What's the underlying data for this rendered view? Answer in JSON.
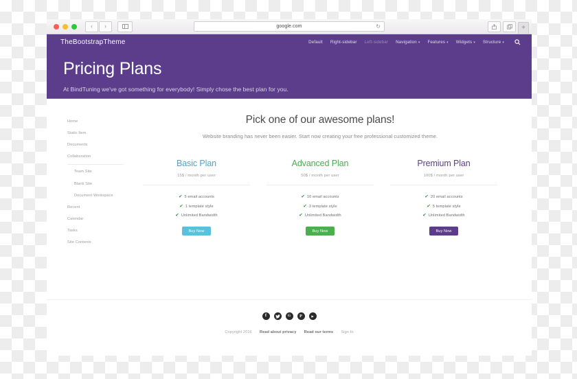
{
  "browser": {
    "traffic_lights": [
      "close",
      "minimize",
      "maximize"
    ],
    "back_label": "‹",
    "forward_label": "›",
    "sidebar_toggle": "sidebar-toggle-icon",
    "url": "google.com",
    "reload_label": "↻",
    "share_icon": "share-icon",
    "tabs_icon": "tabs-icon",
    "new_tab_label": "+"
  },
  "site": {
    "brand": "TheBootstrapTheme",
    "nav": [
      {
        "label": "Default",
        "caret": false,
        "muted": false
      },
      {
        "label": "Right-sidebar",
        "caret": false,
        "muted": false
      },
      {
        "label": "Left-sidebar",
        "caret": false,
        "muted": true
      },
      {
        "label": "Navigation",
        "caret": true,
        "muted": false
      },
      {
        "label": "Features",
        "caret": true,
        "muted": false
      },
      {
        "label": "Widgets",
        "caret": true,
        "muted": false
      },
      {
        "label": "Structure",
        "caret": true,
        "muted": false
      }
    ],
    "search_icon": "search-icon"
  },
  "hero": {
    "title": "Pricing Plans",
    "subtitle": "At BindTuning we've got something for everybody! Simply chose the best plan for you.",
    "background": "#5b3d8c"
  },
  "sidebar": {
    "items": [
      {
        "label": "Home",
        "indent": false
      },
      {
        "label": "Static Item",
        "indent": false
      },
      {
        "label": "Documents",
        "indent": false
      },
      {
        "label": "Collaboration",
        "indent": false
      },
      {
        "label": "Team Site",
        "indent": true
      },
      {
        "label": "Blank Site",
        "indent": true
      },
      {
        "label": "Document Workspace",
        "indent": true
      },
      {
        "label": "Recent",
        "indent": false
      },
      {
        "label": "Calendar",
        "indent": false
      },
      {
        "label": "Tasks",
        "indent": false
      },
      {
        "label": "Site Contents",
        "indent": false
      }
    ]
  },
  "main": {
    "title": "Pick one of our awesome plans!",
    "subtitle": "Website branding has never been easier. Start now creating your free professional customized theme.",
    "plans": [
      {
        "name": "Basic Plan",
        "price": "15$ / month per user",
        "features": [
          "5 email accounts",
          "1 template style",
          "Unlimited Bandwidth"
        ],
        "cta": "Buy Now",
        "color": "#4fa3c7",
        "button_color": "#5bc0de"
      },
      {
        "name": "Advanced Plan",
        "price": "50$ / month per user",
        "features": [
          "10 email accounts",
          "3 template style",
          "Unlimited Bandwidth"
        ],
        "cta": "Buy Now",
        "color": "#4aab52",
        "button_color": "#4cae4c"
      },
      {
        "name": "Premium Plan",
        "price": "100$ / month per user",
        "features": [
          "20 email accounts",
          "5 template style",
          "Unlimited Bandwidth"
        ],
        "cta": "Buy Now",
        "color": "#5b3d8c",
        "button_color": "#5b3d8c"
      }
    ]
  },
  "footer": {
    "social": [
      {
        "name": "facebook-icon",
        "glyph": "f"
      },
      {
        "name": "twitter-icon",
        "glyph": "t"
      },
      {
        "name": "google-plus-icon",
        "glyph": "G"
      },
      {
        "name": "pinterest-icon",
        "glyph": "P"
      },
      {
        "name": "youtube-icon",
        "glyph": "▶"
      }
    ],
    "copyright": "Copyright 2016",
    "links": [
      "Read about privacy",
      "Read our terms",
      "Sign In"
    ],
    "separator": "·"
  }
}
